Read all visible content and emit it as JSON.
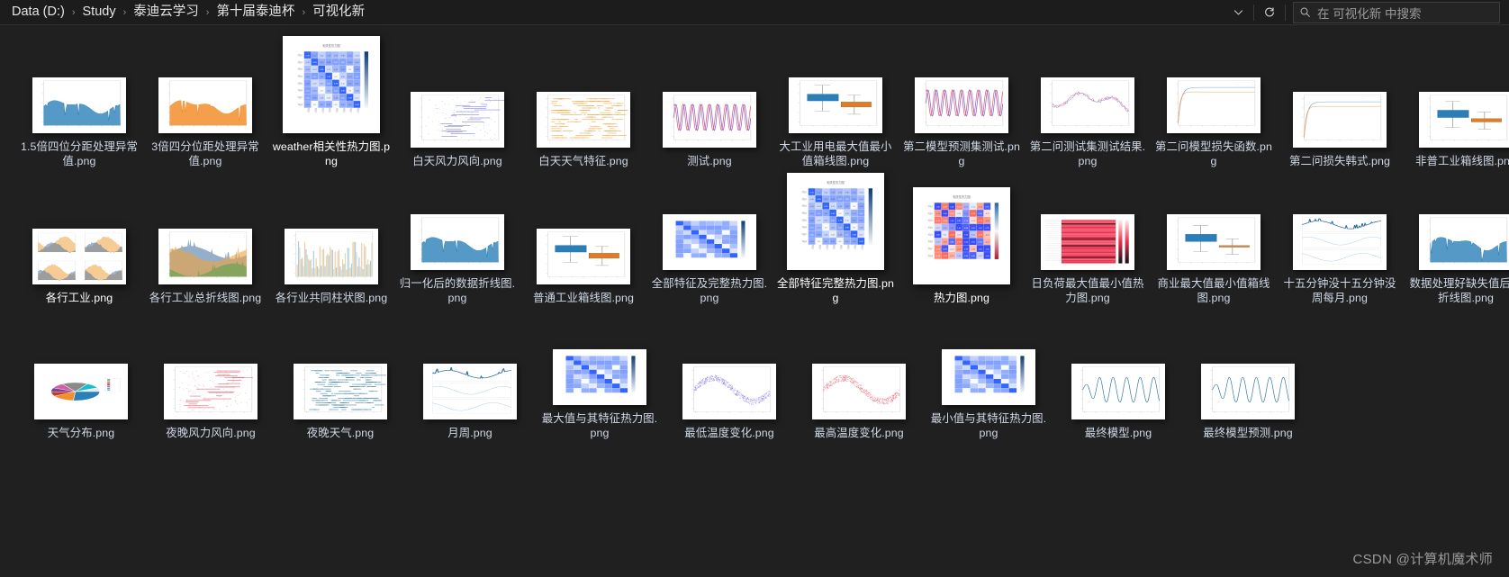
{
  "window": {
    "title": "可视化新",
    "background_color": "#202020",
    "header_color": "#1c1c1c"
  },
  "header": {
    "breadcrumb": [
      {
        "label": "Data (D:)"
      },
      {
        "label": "Study"
      },
      {
        "label": "泰迪云学习"
      },
      {
        "label": "第十届泰迪杯"
      },
      {
        "label": "可视化新"
      }
    ],
    "separator": "›",
    "dropdown_icon": "chevron-down-icon",
    "refresh_icon": "refresh-icon",
    "search": {
      "icon": "search-icon",
      "placeholder": "在 可视化新 中搜索"
    }
  },
  "files": {
    "rows": [
      [
        {
          "name": "1.5倍四位分距处理异常值.png",
          "thumb": "line-blue-dense",
          "size": "wide",
          "selected": false
        },
        {
          "name": "3倍四分位距处理异常值.png",
          "thumb": "line-orange-dense",
          "size": "wide",
          "selected": false
        },
        {
          "name": "weather相关性热力图.png",
          "thumb": "heatmap-blue-labeled",
          "size": "big",
          "selected": true
        },
        {
          "name": "白天风力风向.png",
          "thumb": "scatter-purple-steps",
          "size": "wide",
          "selected": false
        },
        {
          "name": "白天天气特征.png",
          "thumb": "scatter-orange-bands",
          "size": "wide",
          "selected": false
        },
        {
          "name": "测试.png",
          "thumb": "wave-purple-red",
          "size": "wide",
          "selected": false
        },
        {
          "name": "大工业用电最大值最小值箱线图.png",
          "thumb": "boxplot-blue-orange",
          "size": "wide",
          "selected": false
        },
        {
          "name": "第二模型预测集测试.png",
          "thumb": "wave-purple-red",
          "size": "wide",
          "selected": false
        },
        {
          "name": "第二问测试集测试结果.png",
          "thumb": "line-pink-noisy",
          "size": "wide",
          "selected": false
        },
        {
          "name": "第二问模型损失函数.png",
          "thumb": "loss-curve",
          "size": "wide",
          "selected": false
        },
        {
          "name": "第二问损失韩式.png",
          "thumb": "loss-curve-2",
          "size": "wide",
          "selected": false
        },
        {
          "name": "非普工业箱线图.png",
          "thumb": "boxplot-blue-orange-2",
          "size": "wide",
          "selected": false
        }
      ],
      [
        {
          "name": "各行工业.png",
          "thumb": "multi-panel-4",
          "size": "wide",
          "selected": true
        },
        {
          "name": "各行工业总折线图.png",
          "thumb": "line-multi-band",
          "size": "wide",
          "selected": false
        },
        {
          "name": "各行业共同柱状图.png",
          "thumb": "bar-dense-pastel",
          "size": "wide",
          "selected": false
        },
        {
          "name": "归一化后的数据折线图.png",
          "thumb": "line-blue-dense",
          "size": "wide",
          "selected": false
        },
        {
          "name": "普通工业箱线图.png",
          "thumb": "boxplot-blue-orange",
          "size": "wide",
          "selected": false
        },
        {
          "name": "全部特征及完整热力图.png",
          "thumb": "heatmap-blue-small",
          "size": "wide",
          "selected": false
        },
        {
          "name": "全部特征完整热力图.png",
          "thumb": "heatmap-blue-labeled",
          "size": "big",
          "selected": true
        },
        {
          "name": "热力图.png",
          "thumb": "heatmap-redblue-labeled",
          "size": "big",
          "selected": true
        },
        {
          "name": "日负荷最大值最小值热力图.png",
          "thumb": "heatmap-red-stripes",
          "size": "wide",
          "selected": false
        },
        {
          "name": "商业最大值最小值箱线图.png",
          "thumb": "boxplot-blue-orange-3",
          "size": "wide",
          "selected": false
        },
        {
          "name": "十五分钟没十五分钟没周每月.png",
          "thumb": "triple-panel-lines",
          "size": "wide",
          "selected": false
        },
        {
          "name": "数据处理好缺失值后的折线图.png",
          "thumb": "line-blue-dense-2",
          "size": "wide",
          "selected": false
        }
      ],
      [
        {
          "name": "天气分布.png",
          "thumb": "pie-chart",
          "size": "wide",
          "selected": false
        },
        {
          "name": "夜晚风力风向.png",
          "thumb": "scatter-red-steps",
          "size": "wide",
          "selected": false
        },
        {
          "name": "夜晚天气.png",
          "thumb": "scatter-blue-bands",
          "size": "wide",
          "selected": false
        },
        {
          "name": "月周.png",
          "thumb": "triple-panel-lines",
          "size": "wide",
          "selected": false
        },
        {
          "name": "最大值与其特征热力图.png",
          "thumb": "heatmap-blue-small",
          "size": "wide",
          "selected": false
        },
        {
          "name": "最低温度变化.png",
          "thumb": "scatter-wave-purple",
          "size": "wide",
          "selected": false
        },
        {
          "name": "最高温度变化.png",
          "thumb": "scatter-wave-red",
          "size": "wide",
          "selected": false
        },
        {
          "name": "最小值与其特征热力图.png",
          "thumb": "heatmap-blue-small",
          "size": "wide",
          "selected": false
        },
        {
          "name": "最终模型.png",
          "thumb": "wave-blue-osc",
          "size": "wide",
          "selected": false
        },
        {
          "name": "最终模型预测.png",
          "thumb": "wave-blue-osc",
          "size": "wide",
          "selected": false
        }
      ]
    ]
  },
  "watermark": {
    "text": "CSDN @计算机魔术师"
  }
}
